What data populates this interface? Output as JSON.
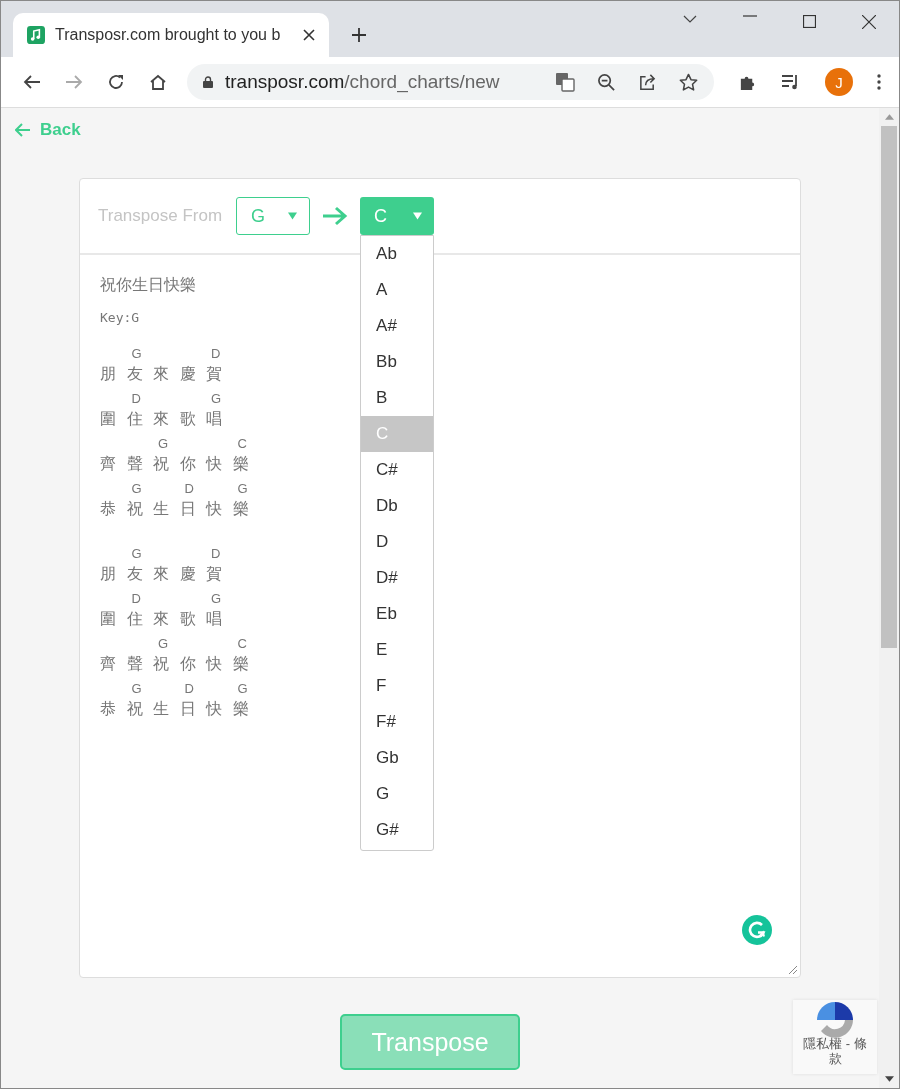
{
  "browser": {
    "tab_title": "Transposr.com brought to you b",
    "url_domain": "transposr.com",
    "url_path": "/chord_charts/new",
    "avatar_letter": "J"
  },
  "back_link": "Back",
  "transpose": {
    "label": "Transpose From",
    "from_key": "G",
    "to_key": "C",
    "dropdown_open": true,
    "options": [
      {
        "label": "Ab",
        "selected": false
      },
      {
        "label": "A",
        "selected": false
      },
      {
        "label": "A#",
        "selected": false
      },
      {
        "label": "Bb",
        "selected": false
      },
      {
        "label": "B",
        "selected": false
      },
      {
        "label": "C",
        "selected": true
      },
      {
        "label": "C#",
        "selected": false
      },
      {
        "label": "Db",
        "selected": false
      },
      {
        "label": "D",
        "selected": false
      },
      {
        "label": "D#",
        "selected": false
      },
      {
        "label": "Eb",
        "selected": false
      },
      {
        "label": "E",
        "selected": false
      },
      {
        "label": "F",
        "selected": false
      },
      {
        "label": "F#",
        "selected": false
      },
      {
        "label": "Gb",
        "selected": false
      },
      {
        "label": "G",
        "selected": false
      },
      {
        "label": "G#",
        "selected": false
      }
    ]
  },
  "chart": {
    "title": "祝你生日快樂",
    "key_line": "Key:G",
    "stanzas": [
      [
        {
          "cells": [
            {
              "char": "朋"
            },
            {
              "char": "友",
              "chord": "G"
            },
            {
              "char": "來"
            },
            {
              "char": "慶"
            },
            {
              "char": "賀",
              "chord": "D"
            }
          ]
        },
        {
          "cells": [
            {
              "char": "圍"
            },
            {
              "char": "住",
              "chord": "D"
            },
            {
              "char": "來"
            },
            {
              "char": "歌"
            },
            {
              "char": "唱",
              "chord": "G"
            }
          ]
        },
        {
          "cells": [
            {
              "char": "齊"
            },
            {
              "char": "聲"
            },
            {
              "char": "祝",
              "chord": "G"
            },
            {
              "char": "你"
            },
            {
              "char": "快"
            },
            {
              "char": "樂",
              "chord": "C"
            }
          ]
        },
        {
          "cells": [
            {
              "char": "恭"
            },
            {
              "char": "祝",
              "chord": "G"
            },
            {
              "char": "生"
            },
            {
              "char": "日",
              "chord": "D"
            },
            {
              "char": "快"
            },
            {
              "char": "樂",
              "chord": "G"
            }
          ]
        }
      ],
      [
        {
          "cells": [
            {
              "char": "朋"
            },
            {
              "char": "友",
              "chord": "G"
            },
            {
              "char": "來"
            },
            {
              "char": "慶"
            },
            {
              "char": "賀",
              "chord": "D"
            }
          ]
        },
        {
          "cells": [
            {
              "char": "圍"
            },
            {
              "char": "住",
              "chord": "D"
            },
            {
              "char": "來"
            },
            {
              "char": "歌"
            },
            {
              "char": "唱",
              "chord": "G"
            }
          ]
        },
        {
          "cells": [
            {
              "char": "齊"
            },
            {
              "char": "聲"
            },
            {
              "char": "祝",
              "chord": "G"
            },
            {
              "char": "你"
            },
            {
              "char": "快"
            },
            {
              "char": "樂",
              "chord": "C"
            }
          ]
        },
        {
          "cells": [
            {
              "char": "恭"
            },
            {
              "char": "祝",
              "chord": "G"
            },
            {
              "char": "生"
            },
            {
              "char": "日",
              "chord": "D"
            },
            {
              "char": "快"
            },
            {
              "char": "樂",
              "chord": "G"
            }
          ]
        }
      ]
    ]
  },
  "transpose_button": "Transpose",
  "recaptcha_text": "隱私權 - 條款"
}
